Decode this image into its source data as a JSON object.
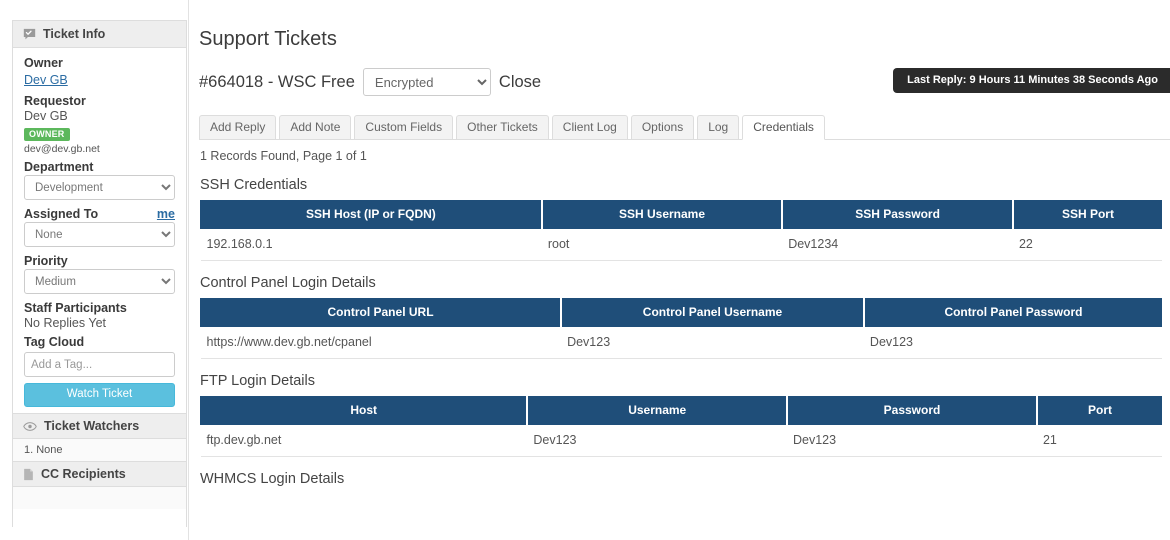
{
  "sidebar": {
    "ticket_info": {
      "header": "Ticket Info",
      "icon": "comment-check-icon",
      "owner_label": "Owner",
      "owner_value": "Dev GB",
      "requestor_label": "Requestor",
      "requestor_value": "Dev GB",
      "owner_badge": "OWNER",
      "email": "dev@dev.gb.net",
      "department_label": "Department",
      "department_value": "Development",
      "assigned_to_label": "Assigned To",
      "assigned_to_me": "me",
      "assigned_to_value": "None",
      "priority_label": "Priority",
      "priority_value": "Medium",
      "staff_participants_label": "Staff Participants",
      "staff_participants_value": "No Replies Yet",
      "tag_cloud_label": "Tag Cloud",
      "tag_placeholder": "Add a Tag...",
      "watch_button": "Watch Ticket"
    },
    "ticket_watchers": {
      "header": "Ticket Watchers",
      "icon": "eye-icon",
      "items": [
        "1. None"
      ]
    },
    "cc_recipients": {
      "header": "CC Recipients",
      "icon": "file-icon"
    }
  },
  "main": {
    "page_title": "Support Tickets",
    "ticket_id": "#664018 - WSC Free",
    "encryption_value": "Encrypted",
    "close_label": "Close",
    "last_reply": "Last Reply: 9 Hours 11 Minutes 38 Seconds Ago",
    "tabs": [
      {
        "label": "Add Reply",
        "active": false
      },
      {
        "label": "Add Note",
        "active": false
      },
      {
        "label": "Custom Fields",
        "active": false
      },
      {
        "label": "Other Tickets",
        "active": false
      },
      {
        "label": "Client Log",
        "active": false
      },
      {
        "label": "Options",
        "active": false
      },
      {
        "label": "Log",
        "active": false
      },
      {
        "label": "Credentials",
        "active": true
      }
    ],
    "records_found": "1 Records Found, Page 1 of 1",
    "sections": [
      {
        "title": "SSH Credentials",
        "columns": [
          "SSH Host (IP or FQDN)",
          "SSH Username",
          "SSH Password",
          "SSH Port"
        ],
        "widths": [
          "35.5%",
          "25%",
          "24%",
          "15.5%"
        ],
        "rows": [
          [
            "192.168.0.1",
            "root",
            "Dev1234",
            "22"
          ]
        ]
      },
      {
        "title": "Control Panel Login Details",
        "columns": [
          "Control Panel URL",
          "Control Panel Username",
          "Control Panel Password"
        ],
        "widths": [
          "37.5%",
          "31.5%",
          "31%"
        ],
        "rows": [
          [
            "https://www.dev.gb.net/cpanel",
            "Dev123",
            "Dev123"
          ]
        ]
      },
      {
        "title": "FTP Login Details",
        "columns": [
          "Host",
          "Username",
          "Password",
          "Port"
        ],
        "widths": [
          "34%",
          "27%",
          "26%",
          "13%"
        ],
        "rows": [
          [
            "ftp.dev.gb.net",
            "Dev123",
            "Dev123",
            "21"
          ]
        ]
      },
      {
        "title": "WHMCS Login Details",
        "columns": [],
        "widths": [],
        "rows": []
      }
    ]
  },
  "colors": {
    "table_header_blue": "#1f4e79",
    "owner_badge_green": "#5cb85c",
    "watch_button_blue": "#5bc0de",
    "link_blue": "#2b6ca3",
    "tooltip_dark": "#2b2b2b"
  }
}
